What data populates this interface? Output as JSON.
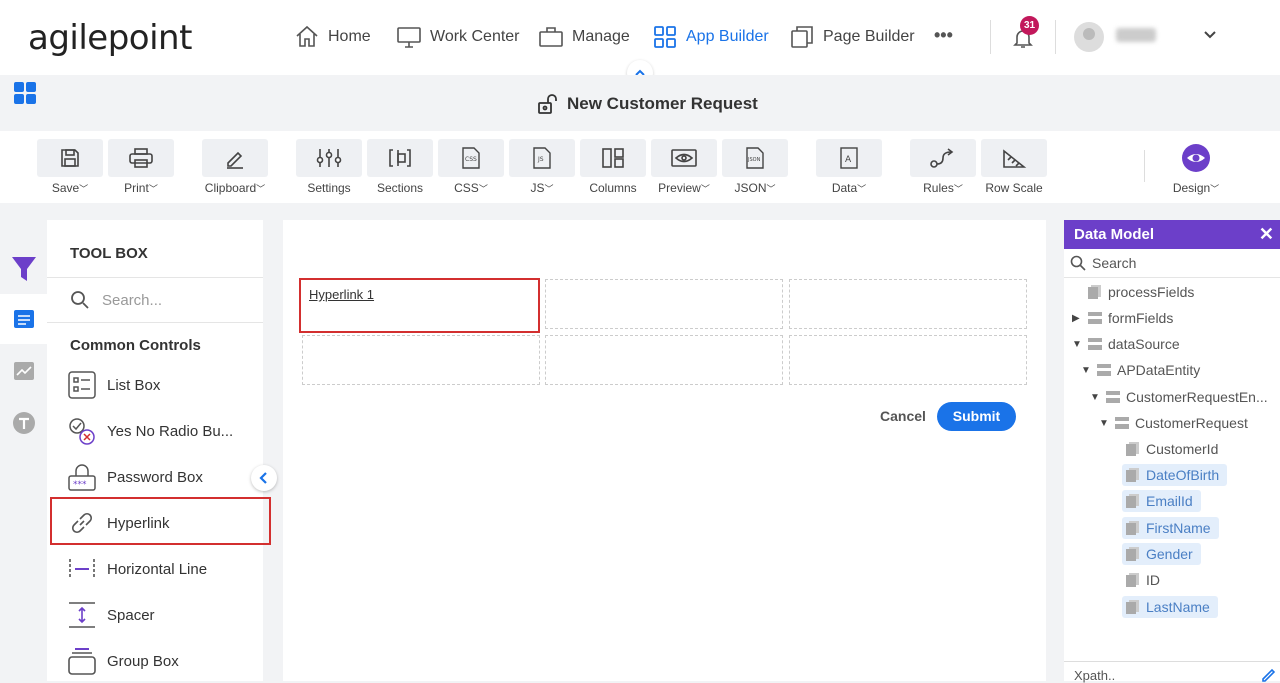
{
  "brand": {
    "logo_text": "agilepoint"
  },
  "nav": {
    "home": "Home",
    "work_center": "Work Center",
    "manage": "Manage",
    "app_builder": "App Builder",
    "page_builder": "Page Builder",
    "more": "•••",
    "notifications_count": "31"
  },
  "title": {
    "page_title": "New Customer Request"
  },
  "ribbon": {
    "save": "Save",
    "print": "Print",
    "clipboard": "Clipboard",
    "settings": "Settings",
    "sections": "Sections",
    "css": "CSS",
    "js": "JS",
    "columns": "Columns",
    "preview": "Preview",
    "json": "JSON",
    "data": "Data",
    "rules": "Rules",
    "row_scale": "Row Scale",
    "design": "Design"
  },
  "toolbox": {
    "title": "TOOL BOX",
    "search_placeholder": "Search...",
    "section": "Common Controls",
    "items": [
      "List Box",
      "Yes No Radio Bu...",
      "Password Box",
      "Hyperlink",
      "Horizontal Line",
      "Spacer",
      "Group Box"
    ]
  },
  "canvas": {
    "hyperlink_label": "Hyperlink 1",
    "cancel": "Cancel",
    "submit": "Submit"
  },
  "data_model": {
    "title": "Data Model",
    "search_placeholder": "Search",
    "nodes": [
      "processFields",
      "formFields",
      "dataSource",
      "APDataEntity",
      "CustomerRequestEn...",
      "CustomerRequest",
      "CustomerId",
      "DateOfBirth",
      "EmailId",
      "FirstName",
      "Gender",
      "ID",
      "LastName"
    ],
    "xpath": "Xpath.."
  },
  "colors": {
    "accent": "#1a73e8",
    "data_model_header": "#6c3fc9",
    "selection": "#d32f2f",
    "notification": "#c2185b"
  }
}
